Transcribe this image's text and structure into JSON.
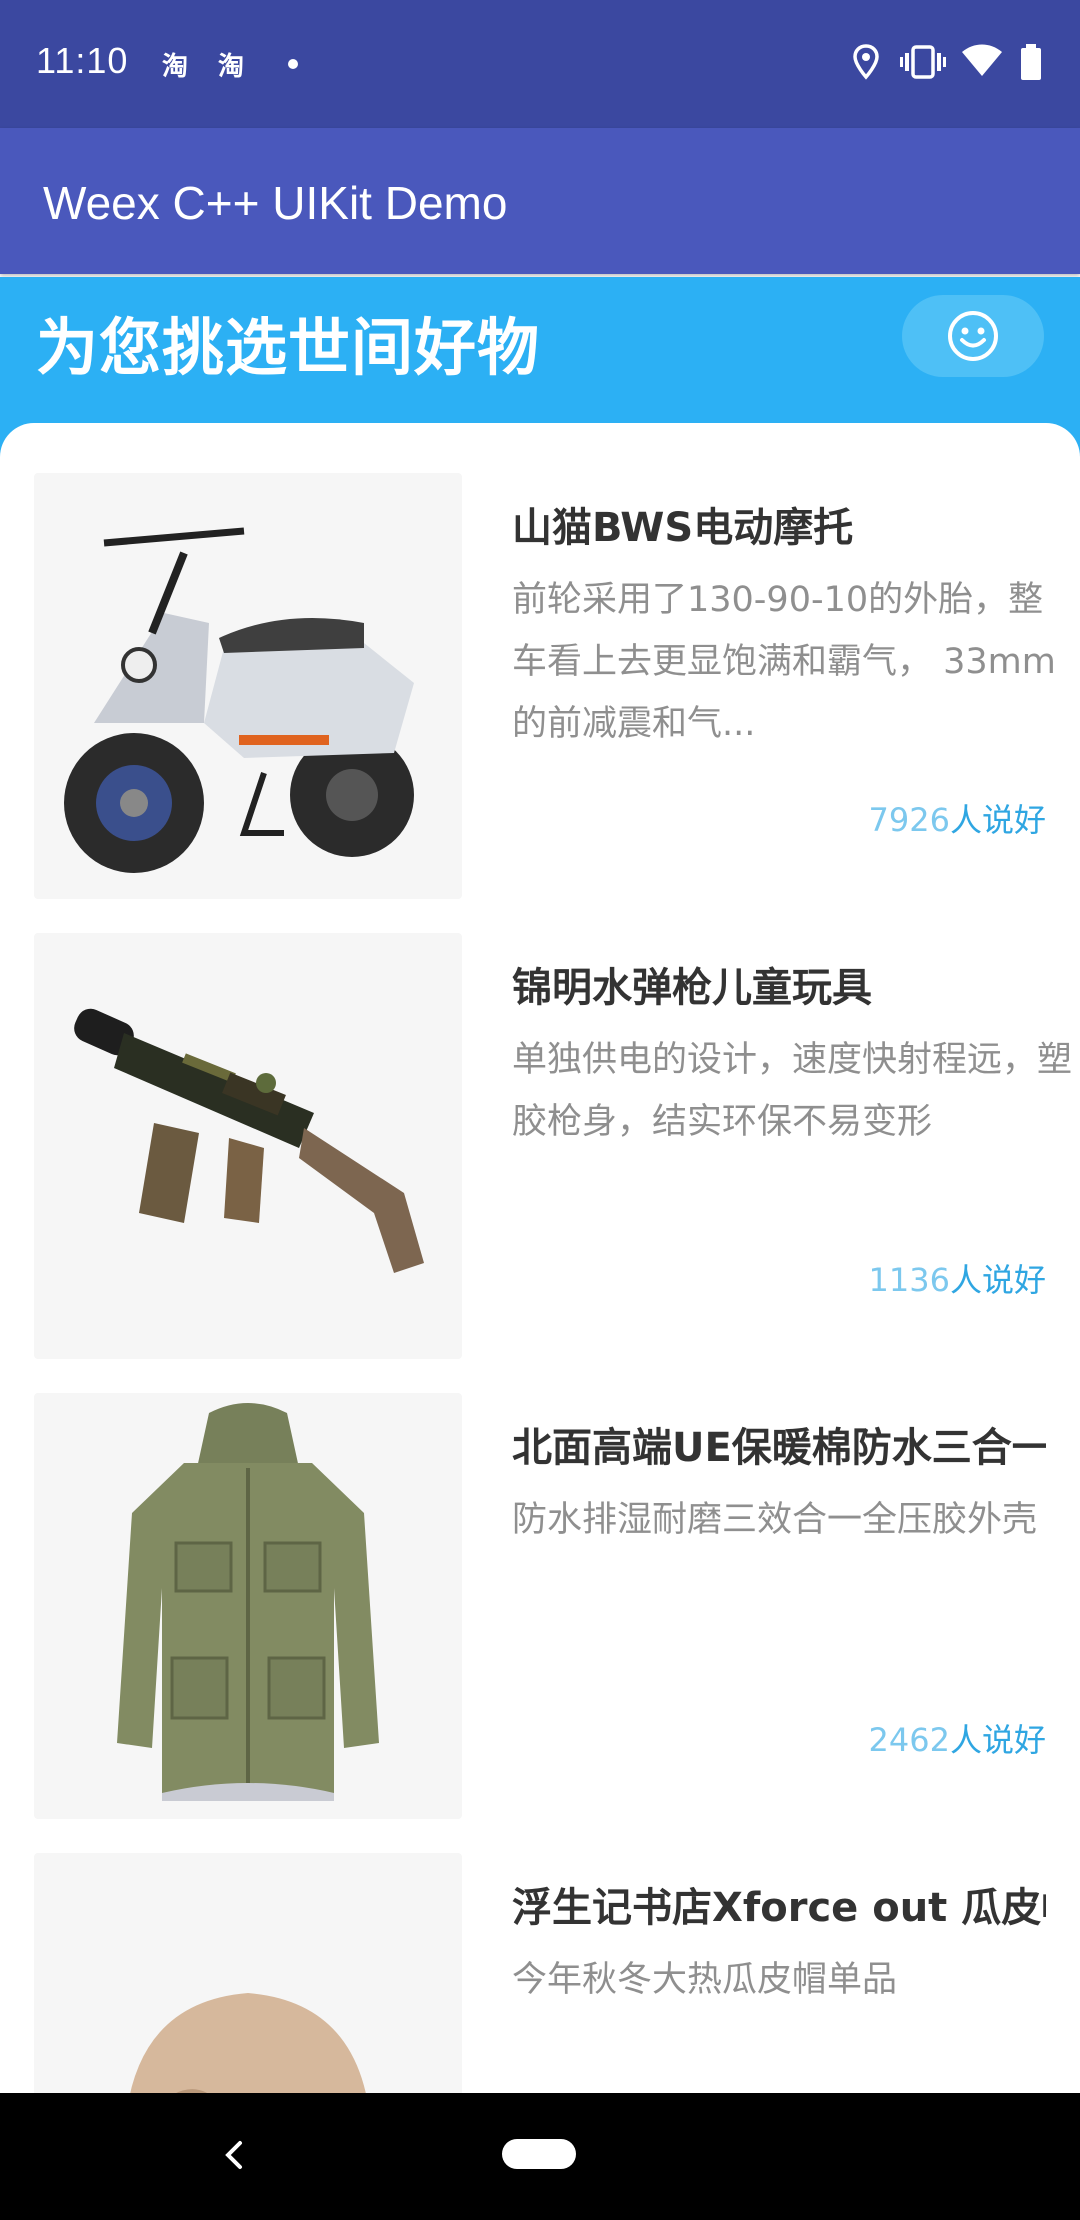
{
  "status_bar": {
    "time": "11:10",
    "app_icons": [
      "淘",
      "淘"
    ],
    "icons": [
      "location-icon",
      "vibrate-icon",
      "wifi-icon",
      "battery-icon"
    ]
  },
  "app_bar": {
    "title": "Weex C++ UIKit Demo"
  },
  "hero": {
    "title": "为您挑选世间好物",
    "button_icon": "smiley-icon"
  },
  "products": [
    {
      "title": "山猫BWS电动摩托",
      "description": "前轮采用了130-90-10的外胎，整车看上去更显饱满和霸气， 33mm的前减震和气...",
      "likes_count": "7926",
      "likes_suffix": "人说好",
      "image_icon": "scooter-image"
    },
    {
      "title": "锦明水弹枪儿童玩具",
      "description": "单独供电的设计，速度快射程远，塑胶枪身，结实环保不易变形",
      "likes_count": "1136",
      "likes_suffix": "人说好",
      "image_icon": "toy-gun-image"
    },
    {
      "title": "北面高端UE保暖棉防水三合一",
      "description": "防水排湿耐磨三效合一全压胶外壳",
      "likes_count": "2462",
      "likes_suffix": "人说好",
      "image_icon": "jacket-image"
    },
    {
      "title": "浮生记书店Xforce out 瓜皮帽",
      "description": "今年秋冬大热瓜皮帽单品",
      "likes_count": "",
      "likes_suffix": "",
      "image_icon": "hat-image"
    }
  ],
  "colors": {
    "status_bar": "#3b48a0",
    "app_bar": "#4a58bc",
    "hero": "#2cb0f4",
    "likes": "#2fa6e2"
  }
}
